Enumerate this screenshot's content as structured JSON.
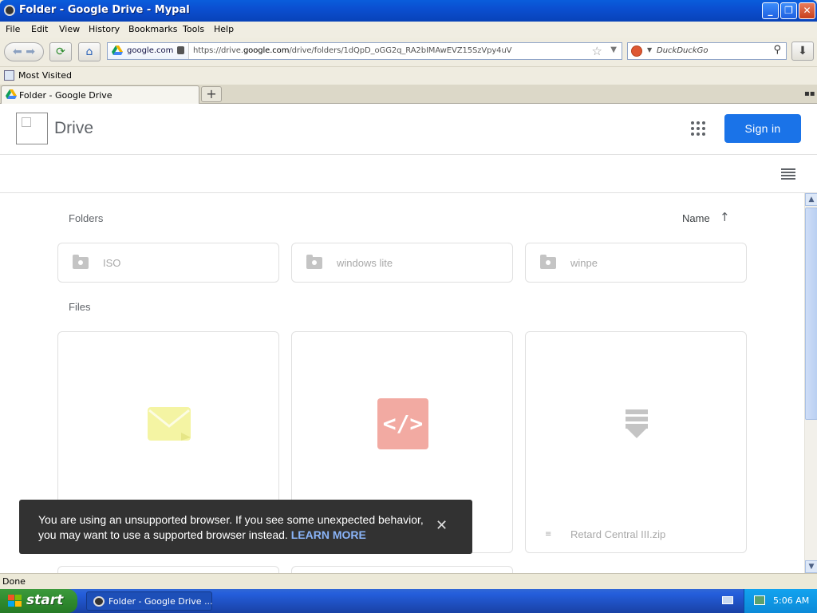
{
  "window": {
    "title": "Folder - Google Drive - Mypal"
  },
  "menu": {
    "items": [
      "File",
      "Edit",
      "View",
      "History",
      "Bookmarks",
      "Tools",
      "Help"
    ]
  },
  "navbar": {
    "identity_domain": "google.com",
    "url_prefix": "https://drive.",
    "url_host": "google.com",
    "url_path": "/drive/folders/1dQpD_oGG2q_RA2bIMAwEVZ15SzVpy4uV",
    "search_engine": "DuckDuckGo"
  },
  "bookmarks": {
    "most_visited": "Most Visited"
  },
  "tabs": [
    {
      "label": "Folder - Google Drive"
    }
  ],
  "drive": {
    "title": "Drive",
    "signin_label": "Sign in",
    "folders_label": "Folders",
    "files_label": "Files",
    "sort_label": "Name",
    "sort_arrow": "↑",
    "folders": [
      {
        "name": "ISO"
      },
      {
        "name": "windows lite"
      },
      {
        "name": "winpe"
      }
    ],
    "files": [
      {
        "name": "",
        "icon": "email-file-icon",
        "color": "#f3f39a"
      },
      {
        "name": "",
        "icon": "code-file-icon",
        "color": "#f2aaa2"
      },
      {
        "name": "Retard Central III.zip",
        "icon": "zip-file-icon",
        "color": "#c4c4c4"
      }
    ]
  },
  "toast": {
    "message": "You are using an unsupported browser. If you see some unexpected behavior, you may want to use a supported browser instead.",
    "link": "LEARN MORE"
  },
  "status": {
    "text": "Done"
  },
  "taskbar": {
    "start_label": "start",
    "task_label": "Folder - Google Drive ...",
    "clock": "5:06 AM"
  },
  "colors": {
    "signin_blue": "#1a73e8",
    "toast_bg": "#323232",
    "learn_more": "#8ab4f8"
  }
}
